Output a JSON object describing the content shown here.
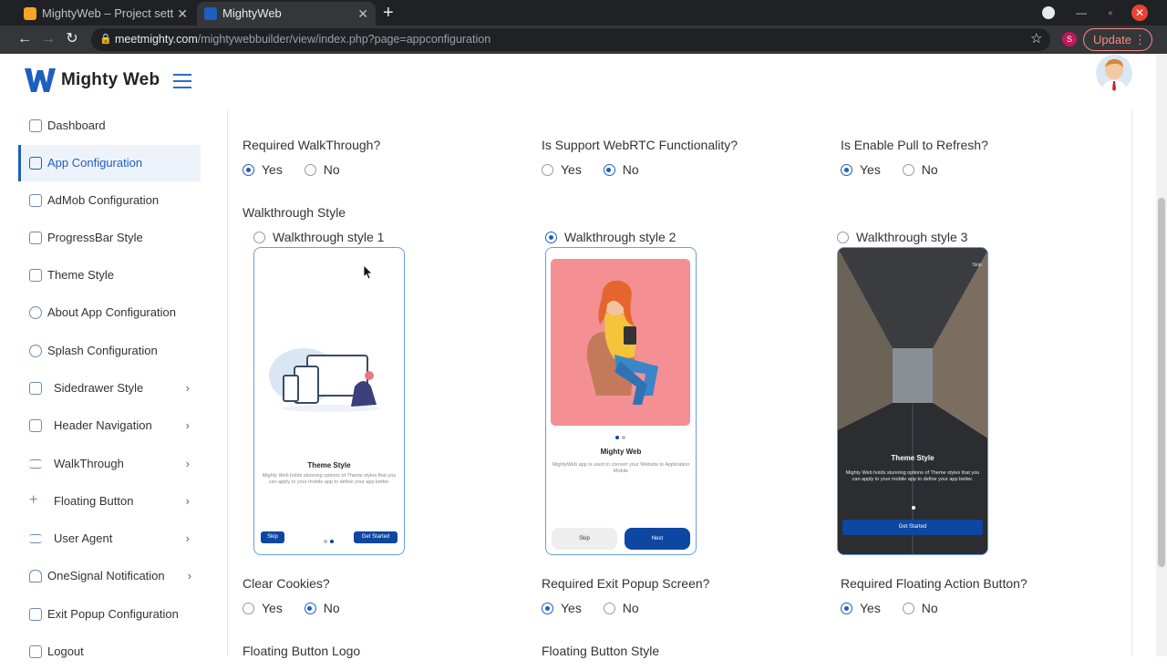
{
  "browser": {
    "tabs": [
      {
        "title": "MightyWeb – Project sett",
        "active": false
      },
      {
        "title": "MightyWeb",
        "active": true
      }
    ],
    "url_host": "meetmighty.com",
    "url_path": "/mightywebbuilder/view/index.php?page=appconfiguration",
    "profile_initial": "S",
    "update_label": "Update"
  },
  "header": {
    "logo_letter": "W",
    "app_name": "Mighty Web"
  },
  "sidebar": {
    "items": [
      {
        "label": "Dashboard",
        "icon": "home-icon"
      },
      {
        "label": "App Configuration",
        "icon": "grid-icon",
        "active": true
      },
      {
        "label": "AdMob Configuration",
        "icon": "chart-icon"
      },
      {
        "label": "ProgressBar Style",
        "icon": "drive-icon"
      },
      {
        "label": "Theme Style",
        "icon": "palette-icon"
      },
      {
        "label": "About App Configuration",
        "icon": "info-icon"
      },
      {
        "label": "Splash Configuration",
        "icon": "info-icon"
      },
      {
        "label": "Sidedrawer Style",
        "icon": "layout-icon",
        "expandable": true
      },
      {
        "label": "Header Navigation",
        "icon": "window-icon",
        "expandable": true
      },
      {
        "label": "WalkThrough",
        "icon": "menu-icon",
        "expandable": true
      },
      {
        "label": "Floating Button",
        "icon": "plus-icon",
        "expandable": true
      },
      {
        "label": "User Agent",
        "icon": "menu-icon",
        "expandable": true
      },
      {
        "label": "OneSignal Notification",
        "icon": "bell-icon",
        "expandable": true
      },
      {
        "label": "Exit Popup Configuration",
        "icon": "close-box-icon"
      },
      {
        "label": "Logout",
        "icon": "logout-icon"
      }
    ]
  },
  "form": {
    "yes": "Yes",
    "no": "No",
    "required_walkthrough": {
      "label": "Required WalkThrough?",
      "value": "Yes"
    },
    "webrtc": {
      "label": "Is Support WebRTC Functionality?",
      "value": "No"
    },
    "pull_refresh": {
      "label": "Is Enable Pull to Refresh?",
      "value": "Yes"
    },
    "walkthrough_style": {
      "label": "Walkthrough Style",
      "options": [
        "Walkthrough style 1",
        "Walkthrough style 2",
        "Walkthrough style 3"
      ],
      "selected": "Walkthrough style 2"
    },
    "clear_cookies": {
      "label": "Clear Cookies?",
      "value": "No"
    },
    "exit_popup": {
      "label": "Required Exit Popup Screen?",
      "value": "Yes"
    },
    "floating_action": {
      "label": "Required Floating Action Button?",
      "value": "Yes"
    },
    "floating_logo_label": "Floating Button Logo",
    "floating_style_label": "Floating Button Style"
  },
  "previews": {
    "style1": {
      "title": "Theme Style",
      "desc": "Mighty Web holds stunning options of Theme styles that you can apply to your mobile app to define your app better.",
      "skip": "Skip",
      "cta": "Get Started"
    },
    "style2": {
      "title": "Mighty Web",
      "desc": "MightyWeb app is used to convert your Website to Application Mobile",
      "skip": "Skip",
      "cta": "Next"
    },
    "style3": {
      "skip_top": "Skip",
      "title": "Theme Style",
      "desc": "Mighty Web holds stunning options of Theme styles that you can apply to your mobile app to define your app better.",
      "cta": "Get Started"
    }
  },
  "colors": {
    "accent": "#1d5fbf",
    "brand_blue": "#0d47a1",
    "preview2_bg": "#f48f93",
    "preview3_bg": "#3b3d42"
  }
}
